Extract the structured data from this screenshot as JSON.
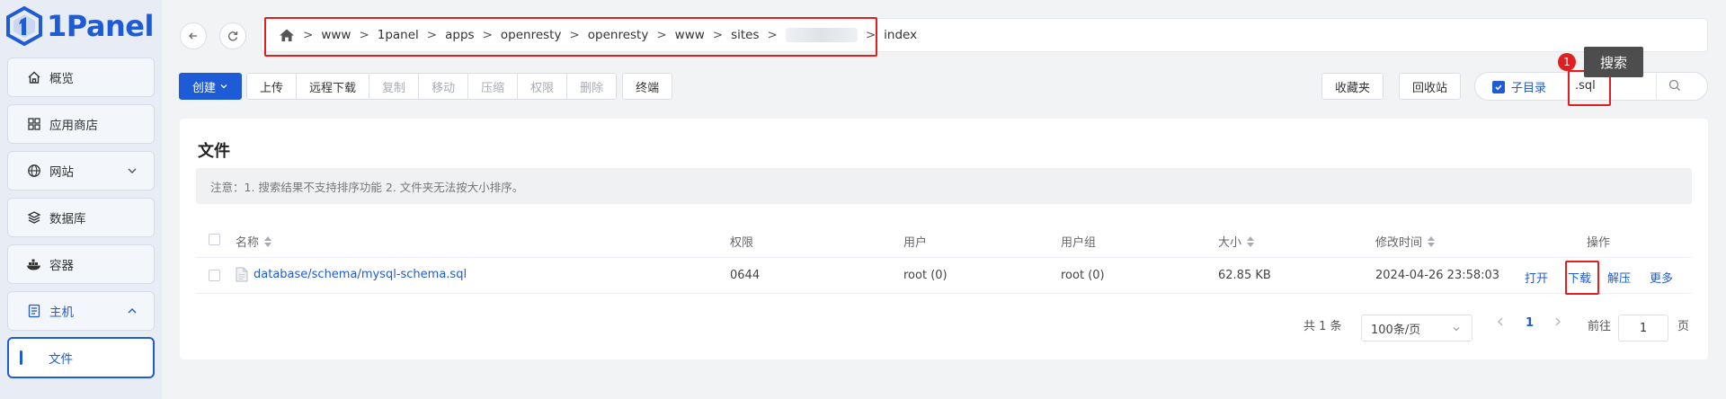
{
  "brand": {
    "name": "1Panel",
    "accent": "#1e5bd6",
    "highlight": "#e02020"
  },
  "sidebar": {
    "items": [
      {
        "label": "概览",
        "icon": "home-icon"
      },
      {
        "label": "应用商店",
        "icon": "grid-icon"
      },
      {
        "label": "网站",
        "icon": "globe-icon"
      },
      {
        "label": "数据库",
        "icon": "layers-icon"
      },
      {
        "label": "容器",
        "icon": "docker-icon"
      },
      {
        "label": "主机",
        "icon": "server-icon"
      }
    ],
    "active_sub": "文件"
  },
  "breadcrumb": {
    "items": [
      "www",
      "1panel",
      "apps",
      "openresty",
      "openresty",
      "www",
      "sites",
      "",
      "index"
    ]
  },
  "toolbar": {
    "create": "创建",
    "upload": "上传",
    "remote_download": "远程下载",
    "copy": "复制",
    "move": "移动",
    "compress": "压缩",
    "permission": "权限",
    "delete": "删除",
    "terminal": "终端",
    "favorites": "收藏夹",
    "recycle": "回收站",
    "sub_dir": "子目录",
    "search_value": ".sql",
    "tooltip": "搜索",
    "badge": "1"
  },
  "card": {
    "title": "文件",
    "notice": "注意：1. 搜索结果不支持排序功能 2. 文件夹无法按大小排序。"
  },
  "table": {
    "headers": {
      "name": "名称",
      "perm": "权限",
      "user": "用户",
      "group": "用户组",
      "size": "大小",
      "mtime": "修改时间",
      "ops": "操作"
    },
    "rows": [
      {
        "name": "database/schema/mysql-schema.sql",
        "perm": "0644",
        "user": "root (0)",
        "group": "root (0)",
        "size": "62.85 KB",
        "mtime": "2024-04-26 23:58:03",
        "ops": {
          "open": "打开",
          "download": "下载",
          "extract": "解压",
          "more": "更多"
        }
      }
    ]
  },
  "pagination": {
    "total": "共 1 条",
    "page_size": "100条/页",
    "current": "1",
    "goto_label": "前往",
    "goto_value": "1",
    "page_unit": "页"
  }
}
